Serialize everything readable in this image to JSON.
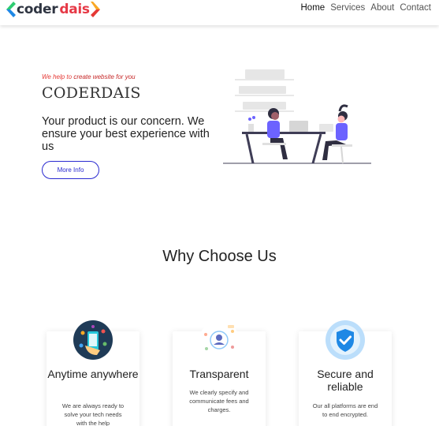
{
  "header": {
    "logo": {
      "part1": "coder",
      "part2": "dais"
    },
    "nav": [
      {
        "label": "Home"
      },
      {
        "label": "Services"
      },
      {
        "label": "About"
      },
      {
        "label": "Contact"
      }
    ]
  },
  "hero": {
    "tagline_prefix": "We help to ",
    "tagline_highlight": "create website for you",
    "brand": "CODERDAIS",
    "headline": "Your product is our concern. We ensure your best experience with us",
    "cta_label": "More Info"
  },
  "why": {
    "title": "Why Choose Us",
    "cards": [
      {
        "title": "Anytime anywhere",
        "text": "We are always ready to solve your tech needs with the help",
        "icon": "phone-globe-icon"
      },
      {
        "title": "Transparent",
        "text": "We clearly specify and communicate fees and charges.",
        "icon": "profile-network-icon"
      },
      {
        "title": "Secure and reliable",
        "text": "Our all platforms are end to end encrypted.",
        "icon": "shield-check-icon"
      }
    ]
  },
  "colors": {
    "brand_dark": "#2f3542",
    "brand_red": "#e63946",
    "accent_blue": "#2a2ad0",
    "illustration_purple": "#6c63ff"
  }
}
